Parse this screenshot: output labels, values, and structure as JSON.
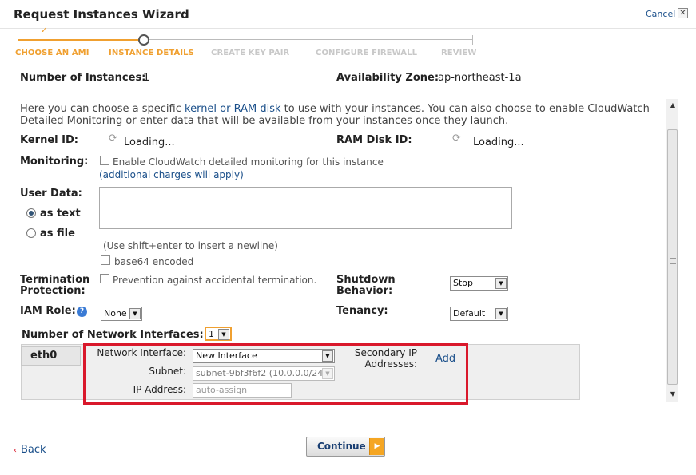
{
  "window": {
    "title": "Request Instances Wizard",
    "cancel_label": "Cancel",
    "close_glyph": "✕"
  },
  "steps": [
    {
      "label": "CHOOSE AN AMI",
      "state": "done"
    },
    {
      "label": "INSTANCE DETAILS",
      "state": "active"
    },
    {
      "label": "CREATE KEY PAIR",
      "state": "todo"
    },
    {
      "label": "CONFIGURE FIREWALL",
      "state": "todo"
    },
    {
      "label": "REVIEW",
      "state": "todo"
    }
  ],
  "summary": {
    "instances_label": "Number of Instances:",
    "instances_value": "1",
    "zone_label": "Availability Zone:",
    "zone_value": "ap-northeast-1a"
  },
  "intro": {
    "part1": "Here you can choose a specific ",
    "link": "kernel or RAM disk",
    "part2": " to use with your instances. You can also choose to enable CloudWatch Detailed Monitoring or enter data that will be available from your instances once they launch."
  },
  "kernel": {
    "label": "Kernel ID:",
    "value": "Loading..."
  },
  "ramdisk": {
    "label": "RAM Disk ID:",
    "value": "Loading..."
  },
  "monitoring": {
    "label": "Monitoring:",
    "checkbox_label": "Enable CloudWatch detailed monitoring for this instance",
    "note": "(additional charges will apply)"
  },
  "user_data": {
    "label": "User Data:",
    "as_text": "as text",
    "as_file": "as file",
    "hint": "(Use shift+enter to insert a newline)",
    "base64_label": "base64 encoded"
  },
  "termination": {
    "label_line1": "Termination",
    "label_line2": "Protection:",
    "checkbox_label": "Prevention against accidental termination."
  },
  "shutdown": {
    "label_line1": "Shutdown",
    "label_line2": "Behavior:",
    "value": "Stop"
  },
  "iam": {
    "label": "IAM Role:",
    "value": "None",
    "help_glyph": "?"
  },
  "tenancy": {
    "label": "Tenancy:",
    "value": "Default"
  },
  "network": {
    "count_label": "Number of Network Interfaces:",
    "count_value": "1",
    "tab": "eth0",
    "interface_label": "Network Interface:",
    "interface_value": "New Interface",
    "subnet_label": "Subnet:",
    "subnet_value": "subnet-9bf3f6f2 (10.0.0.0/24)",
    "ip_label": "IP Address:",
    "ip_placeholder": "auto-assign",
    "secondary_label_line1": "Secondary IP",
    "secondary_label_line2": "Addresses:",
    "add_label": "Add"
  },
  "footer": {
    "back_label": "Back",
    "continue_label": "Continue"
  },
  "colors": {
    "accent_orange": "#f0a030",
    "link_blue": "#1a4f8a",
    "highlight_red": "#d9182b"
  }
}
